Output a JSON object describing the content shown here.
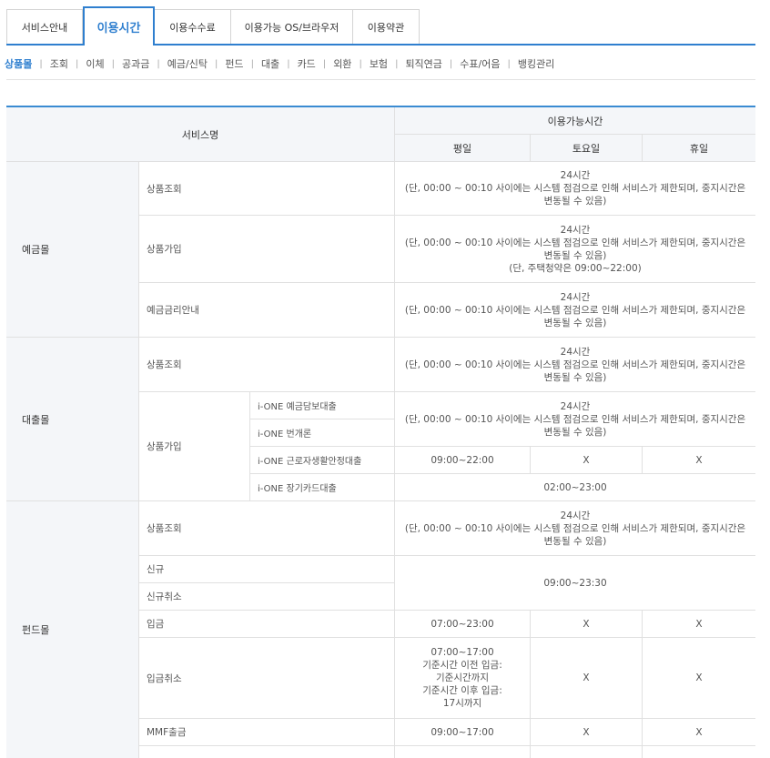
{
  "tabs": [
    {
      "label": "서비스안내",
      "active": false
    },
    {
      "label": "이용시간",
      "active": true
    },
    {
      "label": "이용수수료",
      "active": false
    },
    {
      "label": "이용가능 OS/브라우저",
      "active": false
    },
    {
      "label": "이용약관",
      "active": false
    }
  ],
  "subnav": [
    {
      "label": "상품몰",
      "active": true
    },
    {
      "label": "조회"
    },
    {
      "label": "이체"
    },
    {
      "label": "공과금"
    },
    {
      "label": "예금/신탁"
    },
    {
      "label": "펀드"
    },
    {
      "label": "대출"
    },
    {
      "label": "카드"
    },
    {
      "label": "외환"
    },
    {
      "label": "보험"
    },
    {
      "label": "퇴직연금"
    },
    {
      "label": "수표/어음"
    },
    {
      "label": "뱅킹관리"
    }
  ],
  "table": {
    "header": {
      "service_name": "서비스명",
      "available_time": "이용가능시간",
      "weekday": "평일",
      "saturday": "토요일",
      "holiday": "휴일"
    },
    "common": {
      "h24": "24시간",
      "notice_1": "(단, 00:00 ~ 00:10 사이에는 시스템 점검으로 인해 서비스가 제한되며, 중지시간은",
      "notice_2": "변동될 수 있음)",
      "x": "X"
    },
    "deposit": {
      "group": "예금몰",
      "product_inquiry": "상품조회",
      "product_join": "상품가입",
      "join_extra": "(단, 주택청약은 09:00~22:00)",
      "rate_guide": "예금금리안내"
    },
    "loan": {
      "group": "대출몰",
      "product_inquiry": "상품조회",
      "product_join": "상품가입",
      "items": [
        {
          "name": "i-ONE 예금담보대출"
        },
        {
          "name": "i-ONE 번개론"
        },
        {
          "name": "i-ONE 근로자생활안정대출",
          "weekday": "09:00~22:00"
        },
        {
          "name": "i-ONE 장기카드대출",
          "all": "02:00~23:00"
        }
      ]
    },
    "fund": {
      "group": "펀드몰",
      "product_inquiry": "상품조회",
      "new": "신규",
      "new_cancel": "신규취소",
      "new_time": "09:00~23:30",
      "deposit": "입금",
      "deposit_time": "07:00~23:00",
      "deposit_cancel": "입금취소",
      "deposit_cancel_lines": [
        "07:00~17:00",
        "기준시간 이전 입금:",
        "기준시간까지",
        "기준시간 이후 입금:",
        "17시까지"
      ],
      "mmf": "MMF출금",
      "mmf_time": "09:00~17:00"
    }
  }
}
